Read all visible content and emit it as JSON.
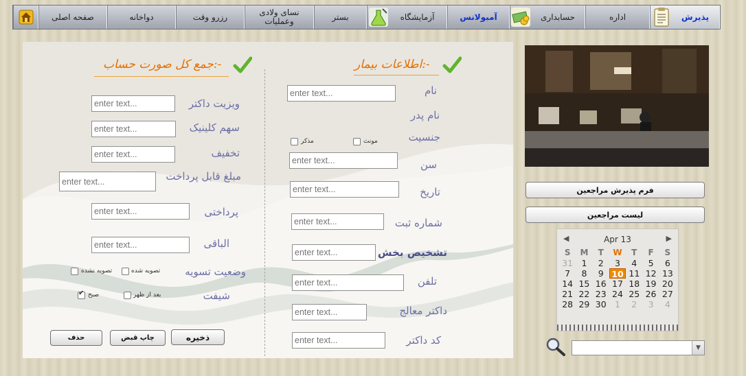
{
  "nav": {
    "tabs": [
      {
        "id": "reception",
        "label": "پذیرش",
        "icon": "clipboard-icon"
      },
      {
        "id": "admin",
        "label": "اداره"
      },
      {
        "id": "accounting",
        "label": "حسابداری",
        "icon": "money-icon"
      },
      {
        "id": "ambulance",
        "label": "آمبولانس"
      },
      {
        "id": "lab",
        "label": "آزمایشگاه",
        "icon": "flask-icon"
      },
      {
        "id": "inpatient",
        "label": "بستر"
      },
      {
        "id": "obgyn",
        "label": "نسای ولادی وعملیات"
      },
      {
        "id": "booking",
        "label": "رزرو وقت"
      },
      {
        "id": "pharmacy",
        "label": "دواخانه"
      },
      {
        "id": "home",
        "label": "صفحه اصلی",
        "icon": "home-icon"
      }
    ]
  },
  "patient": {
    "heading": "اطلاعات بیمار:-",
    "name_label": "نام",
    "father_label": "نام پدر",
    "gender_label": "جنسیت",
    "gender_female": "مونث",
    "gender_male": "مذکر",
    "age_label": "سن",
    "date_label": "تاریخ",
    "reg_label": "شماره ثبت",
    "dept_label": "تشخیص بخش",
    "phone_label": "تلفن",
    "doctor_label": "داکتر معالج",
    "doccode_label": "کد داکتر"
  },
  "bill": {
    "heading": "جمع کل صورت حساب:-",
    "visit_label": "ویزیت داکتر",
    "clinic_label": "سهم کلینیک",
    "discount_label": "تخفیف",
    "payable_label": "مبلغ قابل پرداخت",
    "paid_label": "پرداختی",
    "remain_label": "الباقی",
    "settle_label": "وضعیت تسویه",
    "settled": "تصویه شده",
    "unsettled": "تصویه نشده",
    "shift_label": "شیفت",
    "afternoon": "بعد از ظهر",
    "morning": "صبح"
  },
  "placeholder": "enter text...",
  "buttons": {
    "save": "ذخیره",
    "print": "چاپ قبض",
    "delete": "حذف"
  },
  "side": {
    "form_btn": "فرم پذیرش مراجعین",
    "list_btn": "لیست مراجعین"
  },
  "calendar": {
    "month": "Apr 13",
    "days": [
      "S",
      "M",
      "T",
      "W",
      "T",
      "F",
      "S"
    ],
    "rows": [
      [
        "31",
        "1",
        "2",
        "3",
        "4",
        "5",
        "6"
      ],
      [
        "7",
        "8",
        "9",
        "10",
        "11",
        "12",
        "13"
      ],
      [
        "14",
        "15",
        "16",
        "17",
        "18",
        "19",
        "20"
      ],
      [
        "21",
        "22",
        "23",
        "24",
        "25",
        "26",
        "27"
      ],
      [
        "28",
        "29",
        "30",
        "1",
        "2",
        "3",
        "4"
      ]
    ],
    "today": "10"
  },
  "colors": {
    "heading": "#e47000",
    "label": "#6b6fa6",
    "accent": "#1231c8"
  }
}
